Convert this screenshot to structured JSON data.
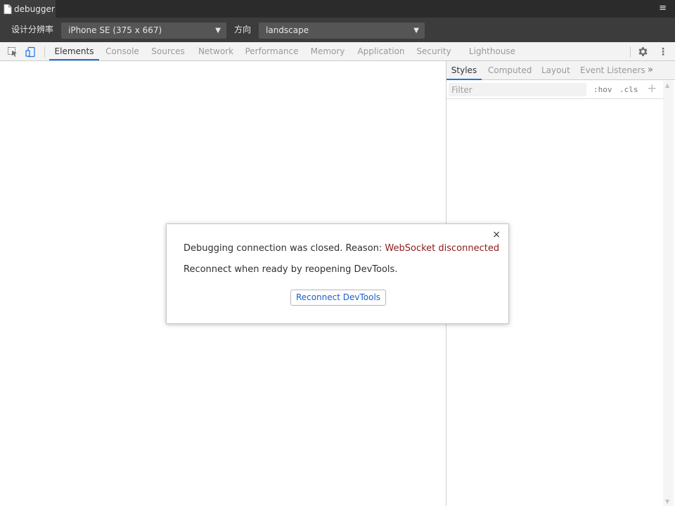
{
  "titlebar": {
    "tab_title": "debugger",
    "menu_glyph": "≡"
  },
  "device_toolbar": {
    "resolution_label": "设计分辨率",
    "resolution_value": "iPhone SE (375 x 667)",
    "orientation_label": "方向",
    "orientation_value": "landscape",
    "dropdown_arrow": "▼"
  },
  "devtools": {
    "tabs": [
      "Elements",
      "Console",
      "Sources",
      "Network",
      "Performance",
      "Memory",
      "Application",
      "Security",
      "Lighthouse"
    ],
    "active_tab": "Elements",
    "kebab_glyph": "⋮"
  },
  "styles_pane": {
    "tabs": [
      "Styles",
      "Computed",
      "Layout",
      "Event Listeners"
    ],
    "active_tab": "Styles",
    "more_glyph": "»",
    "filter_placeholder": "Filter",
    "hov_label": ":hov",
    "cls_label": ".cls",
    "plus_glyph": "+",
    "scroll_up_glyph": "▲",
    "scroll_down_glyph": "▼"
  },
  "dialog": {
    "close_glyph": "×",
    "message_prefix": "Debugging connection was closed. Reason: ",
    "reason": "WebSocket disconnected",
    "message_line2": "Reconnect when ready by reopening DevTools.",
    "button_label": "Reconnect DevTools"
  },
  "colors": {
    "accent": "#1a73e8",
    "reason_text": "#8b1a1a",
    "button_text": "#1a5fc9"
  }
}
